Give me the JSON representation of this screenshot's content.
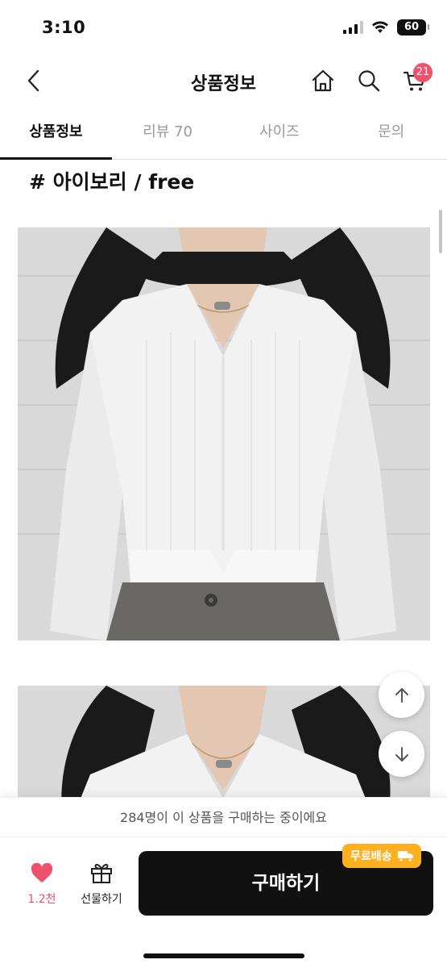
{
  "status_bar": {
    "time": "3:10",
    "battery": "60"
  },
  "header": {
    "title": "상품정보",
    "cart_count": "21"
  },
  "tabs": [
    {
      "label": "상품정보",
      "active": true
    },
    {
      "label": "리뷰 70",
      "active": false
    },
    {
      "label": "사이즈",
      "active": false
    },
    {
      "label": "문의",
      "active": false
    }
  ],
  "content": {
    "option_heading": "# 아이보리 / free",
    "images": [
      {
        "subject": "model wearing ivory cropped knit cardigan with grey trousers"
      },
      {
        "subject": "model wearing ivory cropped knit cardigan, close-up"
      }
    ]
  },
  "bottom": {
    "notice": "284명이 이 상품을 구매하는 중이에요",
    "like_count": "1.2천",
    "gift_label": "선물하기",
    "buy_label": "구매하기",
    "shipping_badge": "무료배송"
  },
  "colors": {
    "accent": "#f0506e",
    "badge": "#ffb020",
    "buy": "#111111"
  }
}
